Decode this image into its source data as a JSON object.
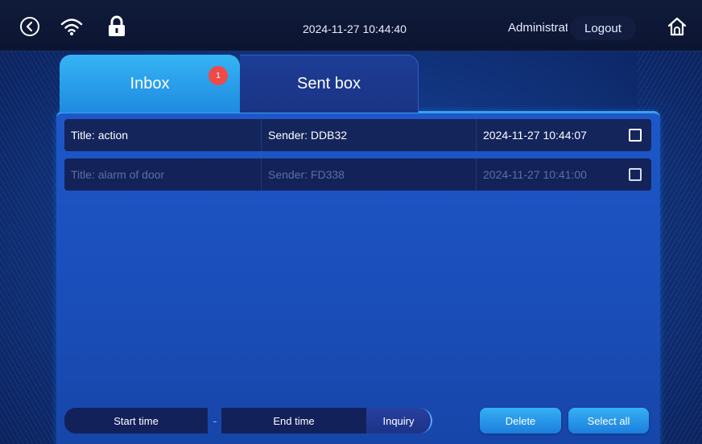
{
  "statusbar": {
    "datetime": "2024-11-27 10:44:40",
    "user": "Administrator",
    "logout_label": "Logout",
    "icons": [
      "back-icon",
      "wifi-icon",
      "lock-icon",
      "home-icon"
    ]
  },
  "tabs": [
    {
      "label": "Inbox",
      "active": true
    },
    {
      "label": "Sent box",
      "active": false
    }
  ],
  "inbox_badge": "1",
  "messages": [
    {
      "title": "Title:  action",
      "sender": "Sender:  DDB32",
      "time": "2024-11-27 10:44:07",
      "read": false
    },
    {
      "title": "Title:  alarm of door",
      "sender": "Sender:  FD338",
      "time": "2024-11-27 10:41:00",
      "read": true
    }
  ],
  "filter": {
    "start_label": "Start time",
    "separator": "-",
    "end_label": "End time",
    "inquiry_label": "Inquiry"
  },
  "actions": {
    "delete_label": "Delete",
    "select_all_label": "Select all"
  },
  "colors": {
    "accent": "#1f8ae0",
    "badge": "#ef4a4a",
    "background": "#123682"
  }
}
